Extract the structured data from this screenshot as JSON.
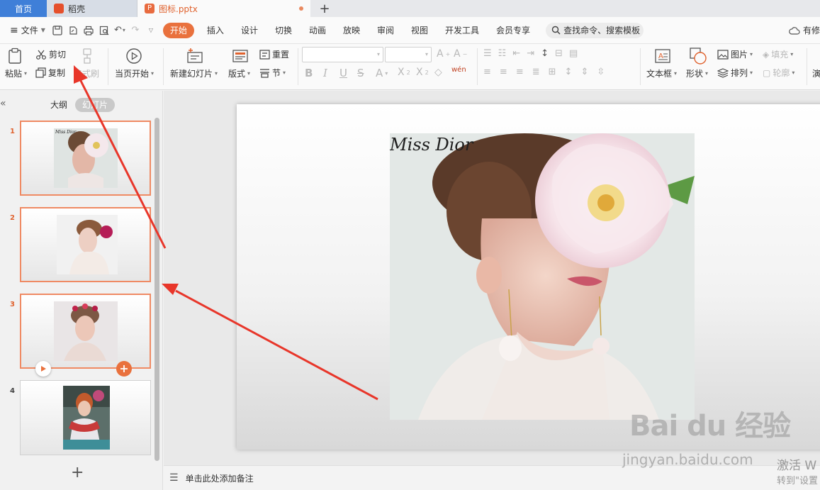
{
  "tabs": {
    "home": "首页",
    "docer": "稻壳",
    "file": "图标.pptx",
    "add": "+"
  },
  "menu": {
    "file": "文件",
    "items": [
      "开始",
      "插入",
      "设计",
      "切换",
      "动画",
      "放映",
      "审阅",
      "视图",
      "开发工具",
      "会员专享"
    ],
    "active_index": 0,
    "search_placeholder": "查找命令、搜索模板",
    "cloud_label": "有修"
  },
  "ribbon": {
    "paste": "粘贴",
    "cut": "剪切",
    "copy": "复制",
    "format_painter": "格式刷",
    "play_from_current": "当页开始",
    "new_slide": "新建幻灯片",
    "layout": "版式",
    "reset": "重置",
    "section": "节",
    "textbox": "文本框",
    "shape": "形状",
    "picture": "图片",
    "arrange": "排列",
    "fill": "填充",
    "outline": "轮廓",
    "present_partial": "演"
  },
  "pane": {
    "outline_tab": "大纲",
    "slides_tab": "幻灯片",
    "slide_numbers": [
      "1",
      "2",
      "3",
      "4"
    ],
    "add_label": "+"
  },
  "slide": {
    "signature": "Miss Dior"
  },
  "notes": {
    "placeholder": "单击此处添加备注"
  },
  "watermark": {
    "brand": "Bai du 经验",
    "url": "jingyan.baidu.com",
    "activate": "激活 W",
    "goto_settings": "转到\"设置"
  },
  "colors": {
    "accent": "#e9713d",
    "home_tab": "#3f7fd8",
    "selection": "#ef8a63",
    "arrow": "#e8362a"
  }
}
